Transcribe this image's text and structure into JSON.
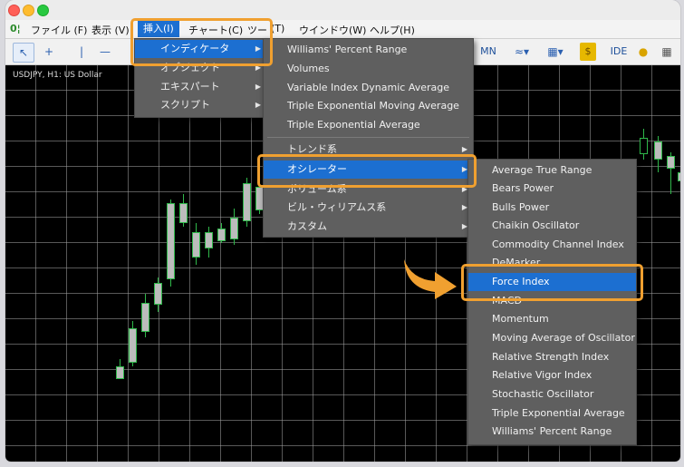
{
  "menubar": {
    "logo": "0¦",
    "items": [
      "ファイル (F)",
      "表示 (V)",
      "挿入(I)",
      "チャート(C)",
      "ツー",
      "(T)",
      "ウインドウ(W)",
      "ヘルプ(H)"
    ]
  },
  "toolbar": {
    "mn": "MN",
    "ide": "IDE"
  },
  "chart": {
    "symbol": "USDJPY, H1:  US Dollar"
  },
  "insert_menu": [
    {
      "label": "インディケータ",
      "submenu": true
    },
    {
      "label": "オブジェクト",
      "submenu": true
    },
    {
      "label": "エキスパート",
      "submenu": true
    },
    {
      "label": "スクリプト",
      "submenu": true
    }
  ],
  "indicators_menu": {
    "items": [
      "Williams' Percent Range",
      "Volumes",
      "Variable Index Dynamic Average",
      "Triple Exponential Moving Average",
      "Triple Exponential Average"
    ],
    "groups": [
      {
        "label": "トレンド系",
        "submenu": true
      },
      {
        "label": "オシレーター",
        "submenu": true
      },
      {
        "label": "ボリューム系",
        "submenu": true
      },
      {
        "label": "ビル・ウィリアムス系",
        "submenu": true
      },
      {
        "label": "カスタム",
        "submenu": true
      }
    ]
  },
  "oscillator_menu": [
    "Average True Range",
    "Bears Power",
    "Bulls Power",
    "Chaikin Oscillator",
    "Commodity Channel Index",
    "DeMarker",
    "Force Index",
    "MACD",
    "Momentum",
    "Moving Average of Oscillator",
    "Relative Strength Index",
    "Relative Vigor Index",
    "Stochastic Oscillator",
    "Triple Exponential Average",
    "Williams' Percent Range"
  ],
  "colors": {
    "selection": "#1c6fd1",
    "highlight": "#f0a030",
    "menu_bg": "#5f5f5f",
    "candle": "#2fb84a"
  }
}
